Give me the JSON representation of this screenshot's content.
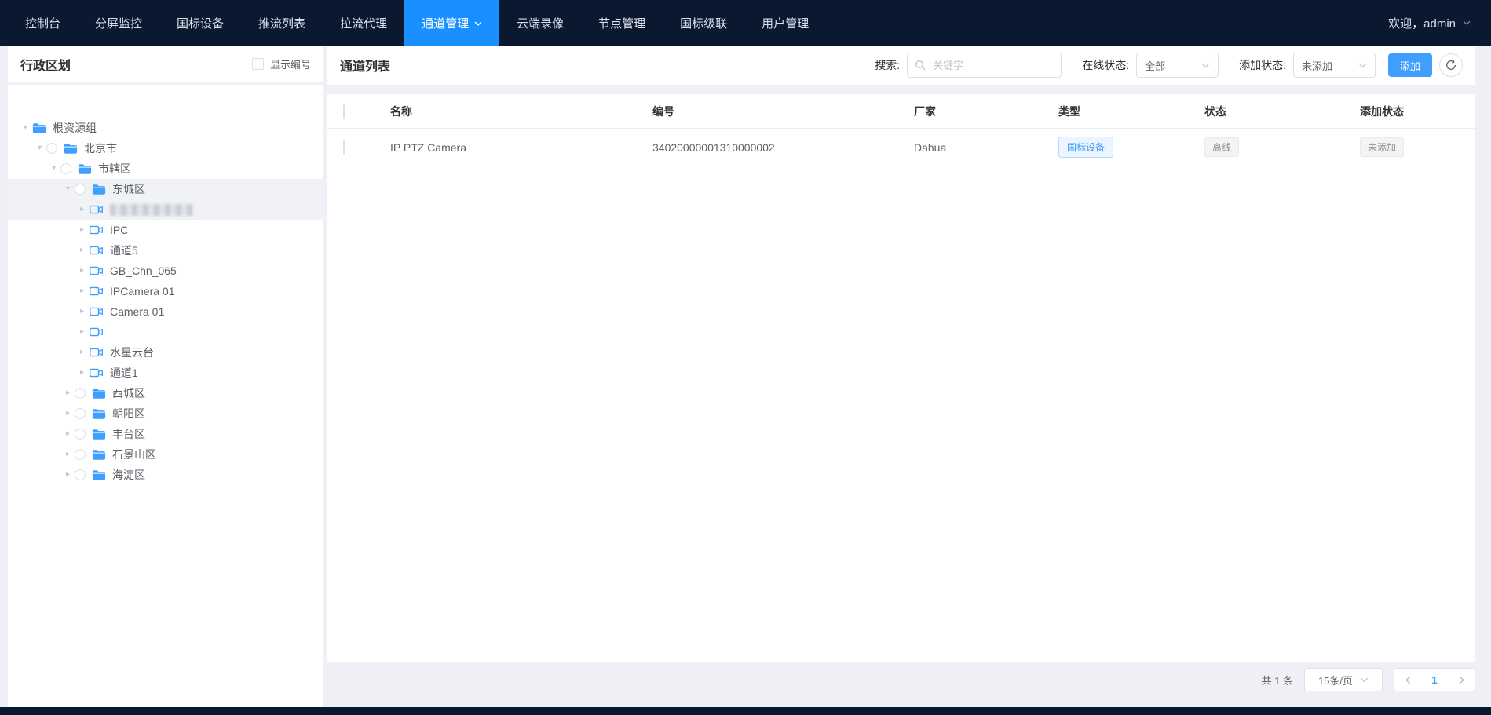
{
  "nav": {
    "items": [
      {
        "label": "控制台"
      },
      {
        "label": "分屏监控"
      },
      {
        "label": "国标设备"
      },
      {
        "label": "推流列表"
      },
      {
        "label": "拉流代理"
      },
      {
        "label": "通道管理",
        "active": true,
        "dropdown": true
      },
      {
        "label": "云端录像"
      },
      {
        "label": "节点管理"
      },
      {
        "label": "国标级联"
      },
      {
        "label": "用户管理"
      }
    ],
    "welcome": "欢迎，admin"
  },
  "left_panel": {
    "title": "行政区划",
    "show_number_label": "显示编号",
    "show_number_checked": false,
    "tree": [
      {
        "label": "根资源组",
        "level": 0,
        "icon": "folder",
        "caret": "expanded",
        "radio": false
      },
      {
        "label": "北京市",
        "level": 1,
        "icon": "folder",
        "caret": "expanded",
        "radio": true
      },
      {
        "label": "市辖区",
        "level": 2,
        "icon": "folder",
        "caret": "expanded",
        "radio": true
      },
      {
        "label": "东城区",
        "level": 3,
        "icon": "folder",
        "caret": "expanded",
        "radio": true,
        "selected": true
      },
      {
        "label": "",
        "level": 4,
        "icon": "camera",
        "caret": "collapsed",
        "radio": false,
        "censored": true,
        "selected": true
      },
      {
        "label": "IPC",
        "level": 4,
        "icon": "camera",
        "caret": "collapsed",
        "radio": false
      },
      {
        "label": "通道5",
        "level": 4,
        "icon": "camera",
        "caret": "collapsed",
        "radio": false
      },
      {
        "label": "GB_Chn_065",
        "level": 4,
        "icon": "camera",
        "caret": "collapsed",
        "radio": false
      },
      {
        "label": "IPCamera 01",
        "level": 4,
        "icon": "camera",
        "caret": "collapsed",
        "radio": false
      },
      {
        "label": "Camera 01",
        "level": 4,
        "icon": "camera",
        "caret": "collapsed",
        "radio": false
      },
      {
        "label": "",
        "level": 4,
        "icon": "camera",
        "caret": "collapsed",
        "radio": false
      },
      {
        "label": "水星云台",
        "level": 4,
        "icon": "camera",
        "caret": "collapsed",
        "radio": false
      },
      {
        "label": "通道1",
        "level": 4,
        "icon": "camera",
        "caret": "collapsed",
        "radio": false
      },
      {
        "label": "西城区",
        "level": 3,
        "icon": "folder",
        "caret": "collapsed",
        "radio": true
      },
      {
        "label": "朝阳区",
        "level": 3,
        "icon": "folder",
        "caret": "collapsed",
        "radio": true
      },
      {
        "label": "丰台区",
        "level": 3,
        "icon": "folder",
        "caret": "collapsed",
        "radio": true
      },
      {
        "label": "石景山区",
        "level": 3,
        "icon": "folder",
        "caret": "collapsed",
        "radio": true
      },
      {
        "label": "海淀区",
        "level": 3,
        "icon": "folder",
        "caret": "collapsed",
        "radio": true
      }
    ]
  },
  "toolbar": {
    "title": "通道列表",
    "search_label": "搜索:",
    "search_placeholder": "关键字",
    "search_value": "",
    "online_label": "在线状态:",
    "online_value": "全部",
    "add_state_label": "添加状态:",
    "add_state_value": "未添加",
    "add_button": "添加"
  },
  "table": {
    "columns": [
      "名称",
      "编号",
      "厂家",
      "类型",
      "状态",
      "添加状态"
    ],
    "rows": [
      {
        "name": "IP PTZ Camera",
        "code": "34020000001310000002",
        "vendor": "Dahua",
        "type": "国标设备",
        "status": "离线",
        "add_status": "未添加"
      }
    ]
  },
  "pagination": {
    "total": "共 1 条",
    "page_size": "15条/页",
    "current_page": "1"
  },
  "colors": {
    "nav_bg": "#0a1930",
    "active_tab": "#1890ff",
    "accent": "#409eff",
    "page_bg": "#eef0f5",
    "tree_selected_bg": "#f0f2f5",
    "badge_gray_text": "#909399"
  }
}
